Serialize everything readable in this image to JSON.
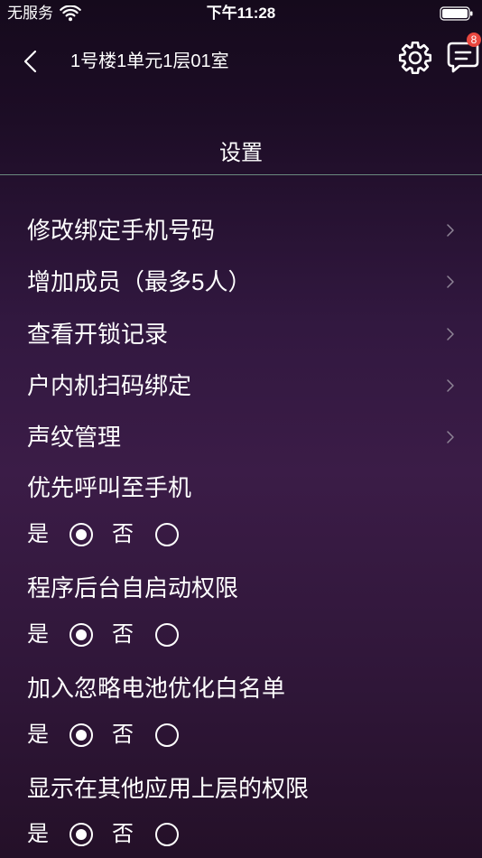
{
  "status_bar": {
    "carrier": "无服务",
    "time": "下午11:28",
    "icons": {
      "wifi": "wifi-icon",
      "battery": "battery-icon"
    }
  },
  "header": {
    "title": "1号楼1单元1层01室",
    "back_icon": "chevron-left-icon",
    "settings_icon": "gear-icon",
    "messages_icon": "message-icon",
    "messages_badge": "8"
  },
  "page": {
    "title": "设置"
  },
  "menu": [
    {
      "label": "修改绑定手机号码",
      "icon": "chevron-right-icon"
    },
    {
      "label": "增加成员（最多5人）",
      "icon": "chevron-right-icon"
    },
    {
      "label": "查看开锁记录",
      "icon": "chevron-right-icon"
    },
    {
      "label": "户内机扫码绑定",
      "icon": "chevron-right-icon"
    },
    {
      "label": "声纹管理",
      "icon": "chevron-right-icon"
    }
  ],
  "options": [
    {
      "label": "优先呼叫至手机",
      "yes": "是",
      "no": "否",
      "selected": "yes"
    },
    {
      "label": "程序后台自启动权限",
      "yes": "是",
      "no": "否",
      "selected": "yes"
    },
    {
      "label": "加入忽略电池优化白名单",
      "yes": "是",
      "no": "否",
      "selected": "yes"
    },
    {
      "label": "显示在其他应用上层的权限",
      "yes": "是",
      "no": "否",
      "selected": "yes"
    }
  ],
  "colors": {
    "background_top": "#150a1c",
    "background_mid": "#3b1c47",
    "background_bottom": "#241028",
    "text": "#ffffff",
    "divider": "#6b8a7e",
    "chevron": "#8e8496",
    "badge": "#e8473f"
  }
}
